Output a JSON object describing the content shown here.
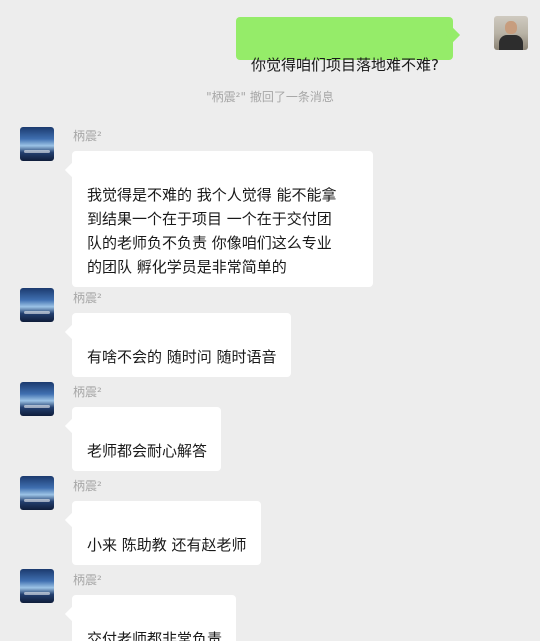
{
  "sent_message": {
    "text": "你觉得咱们项目落地难不难?"
  },
  "system_notice": "\"柄震²\" 撤回了一条消息",
  "received_messages": [
    {
      "sender": "柄震²",
      "text": "我觉得是不难的 我个人觉得 能不能拿\n到结果一个在于项目 一个在于交付团\n队的老师负不负责 你像咱们这么专业\n的团队 孵化学员是非常简单的"
    },
    {
      "sender": "柄震²",
      "text": "有啥不会的 随时问 随时语音"
    },
    {
      "sender": "柄震²",
      "text": "老师都会耐心解答"
    },
    {
      "sender": "柄震²",
      "text": "小来 陈助教 还有赵老师"
    },
    {
      "sender": "柄震²",
      "text": "交付老师都非常负责"
    }
  ]
}
